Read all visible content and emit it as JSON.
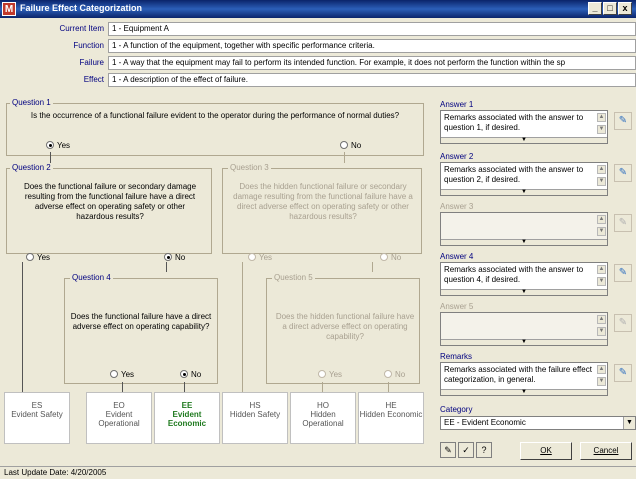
{
  "window": {
    "app_icon_glyph": "M",
    "title": "Failure Effect Categorization",
    "minimize_glyph": "_",
    "maximize_glyph": "□",
    "close_glyph": "x"
  },
  "info": {
    "current_item_label": "Current Item",
    "current_item_value": "1 - Equipment A",
    "function_label": "Function",
    "function_value": "1 - A function of the equipment, together with specific performance criteria.",
    "failure_label": "Failure",
    "failure_value": "1 - A way that the equipment may fail to perform its intended function. For example, it does not perform the function within the sp",
    "effect_label": "Effect",
    "effect_value": "1 - A description of the effect of failure."
  },
  "questions": {
    "q1": {
      "label": "Question 1",
      "text": "Is the occurrence of a functional failure evident to the operator during the performance of normal duties?",
      "yes": "Yes",
      "no": "No",
      "selected": "yes"
    },
    "q2": {
      "label": "Question 2",
      "text": "Does the functional failure or secondary damage resulting from the functional failure have a direct adverse effect on operating safety or other hazardous results?",
      "yes": "Yes",
      "no": "No",
      "selected": "no"
    },
    "q3": {
      "label": "Question 3",
      "text": "Does the hidden functional failure or secondary damage resulting from the functional failure have a direct adverse effect on operating safety or other hazardous results?",
      "yes": "Yes",
      "no": "No",
      "selected": "none"
    },
    "q4": {
      "label": "Question 4",
      "text": "Does the functional failure have a direct adverse effect on operating capability?",
      "yes": "Yes",
      "no": "No",
      "selected": "no"
    },
    "q5": {
      "label": "Question 5",
      "text": "Does the hidden functional failure have a direct adverse effect on operating capability?",
      "yes": "Yes",
      "no": "No",
      "selected": "none"
    }
  },
  "categories": [
    {
      "code": "ES",
      "name": "Evident Safety",
      "selected": false
    },
    {
      "code": "EO",
      "name": "Evident Operational",
      "selected": false
    },
    {
      "code": "EE",
      "name": "Evident Economic",
      "selected": true
    },
    {
      "code": "HS",
      "name": "Hidden Safety",
      "selected": false
    },
    {
      "code": "HO",
      "name": "Hidden Operational",
      "selected": false
    },
    {
      "code": "HE",
      "name": "Hidden Economic",
      "selected": false
    }
  ],
  "category_colors": {
    "selected": "#1f7a1f",
    "normal": "#555555"
  },
  "answers": {
    "a1": {
      "label": "Answer 1",
      "text": "Remarks associated with the answer to question 1, if desired."
    },
    "a2": {
      "label": "Answer 2",
      "text": "Remarks associated with the answer to question 2, if desired."
    },
    "a3": {
      "label": "Answer 3",
      "text": ""
    },
    "a4": {
      "label": "Answer 4",
      "text": "Remarks associated with the answer to question 4, if desired."
    },
    "a5": {
      "label": "Answer 5",
      "text": ""
    },
    "remarks": {
      "label": "Remarks",
      "text": "Remarks associated with the failure effect categorization, in general."
    }
  },
  "category_select": {
    "label": "Category",
    "value": "EE - Evident Economic"
  },
  "buttons": {
    "ok": "OK",
    "cancel": "Cancel"
  },
  "toolbar_icons": [
    "edit-icon",
    "spellcheck-icon",
    "help-icon"
  ],
  "status": {
    "last_update": "Last Update Date: 4/20/2005"
  }
}
